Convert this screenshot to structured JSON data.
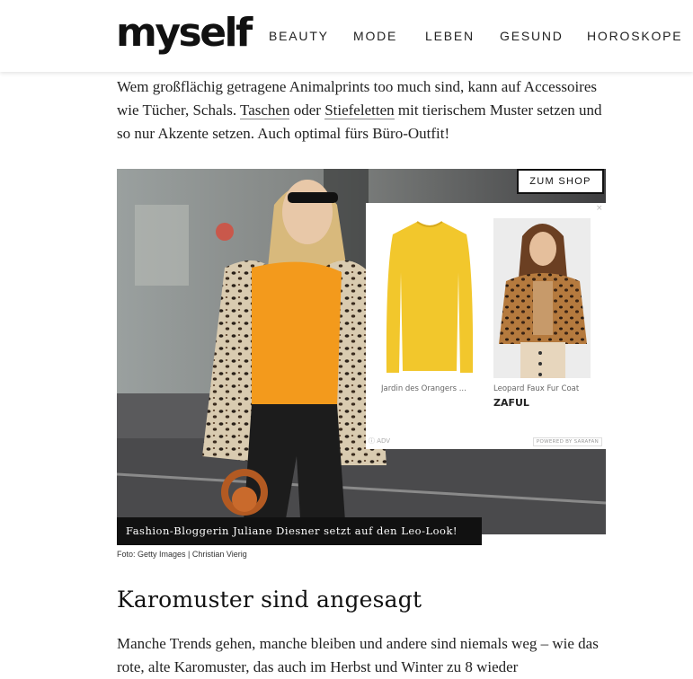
{
  "header": {
    "logo": "myself",
    "nav": [
      "BEAUTY",
      "MODE",
      "LEBEN",
      "GESUND",
      "HOROSKOPE"
    ]
  },
  "intro": {
    "text_before": "Wem großflächig getragene Animalprints too much sind, kann auf Accessoires wie Tücher, Schals. ",
    "link1": "Taschen",
    "text_mid": " oder ",
    "link2": "Stiefeletten",
    "text_after": " mit tierischem Muster setzen und so nur Akzente setzen. Auch optimal fürs Büro-Outfit!"
  },
  "image": {
    "shop_button": "ZUM SHOP",
    "caption": "Fashion-Bloggerin Juliane Diesner setzt auf den Leo-Look!",
    "credit": "Foto: Getty Images | Christian Vierig"
  },
  "shop_panel": {
    "close": "×",
    "products": [
      {
        "name": "Jardin des Orangers ...",
        "brand": ""
      },
      {
        "name": "Leopard Faux Fur Coat",
        "brand": "ZAFUL"
      }
    ],
    "adv": "ADV",
    "powered": "POWERED BY SARAFAN"
  },
  "section": {
    "heading": "Karomuster sind angesagt",
    "text": "Manche Trends gehen, manche bleiben und andere sind niemals weg –  wie das rote, alte Karomuster, das auch im Herbst und Winter zu 8 wieder"
  },
  "colors": {
    "sweater_yellow": "#f2c72c",
    "orange_top": "#f39a1c",
    "caption_bg": "#111111"
  }
}
